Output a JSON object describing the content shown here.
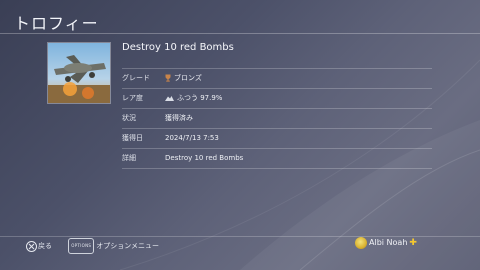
{
  "page": {
    "title": "トロフィー"
  },
  "trophy": {
    "name": "Destroy 10 red Bombs",
    "rows": [
      {
        "label": "グレード",
        "value": "ブロンズ",
        "icon": "bronze-trophy-icon"
      },
      {
        "label": "レア度",
        "value": "ふつう  97.9%",
        "icon": "rarity-common-icon"
      },
      {
        "label": "状況",
        "value": "獲得済み"
      },
      {
        "label": "獲得日",
        "value": "2024/7/13   7:53"
      },
      {
        "label": "詳細",
        "value": "Destroy 10 red Bombs"
      }
    ]
  },
  "footer": {
    "back_label": "戻る",
    "options_badge": "OPTIONS",
    "options_label": "オプションメニュー",
    "user_name": "Albi Noah",
    "plus_symbol": "✚"
  },
  "colors": {
    "bronze": "#c8844a",
    "ps_plus": "#f5c82f"
  }
}
